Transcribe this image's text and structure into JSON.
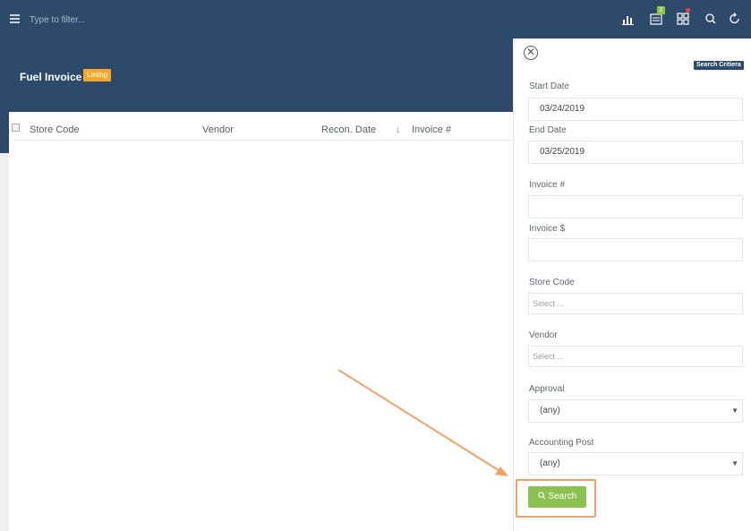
{
  "topbar": {
    "filter_placeholder": "Type to filter...",
    "notification_count": "2",
    "icons": [
      "menu-icon",
      "bar-chart-icon",
      "list-icon",
      "grid-icon",
      "search-icon",
      "refresh-icon"
    ]
  },
  "page": {
    "title": "Fuel Invoice",
    "badge": "Listing"
  },
  "table": {
    "columns": [
      "Store Code",
      "Vendor",
      "Recon. Date",
      "↓",
      "Invoice #"
    ]
  },
  "panel": {
    "badge": "Search Critiera",
    "close_symbol": "✕",
    "start_date_label": "Start Date",
    "start_date_value": "03/24/2019",
    "end_date_label": "End Date",
    "end_date_value": "03/25/2019",
    "invoice_no_label": "Invoice #",
    "invoice_amt_label": "Invoice $",
    "store_code_label": "Store Code",
    "store_code_placeholder": "Select ...",
    "vendor_label": "Vendor",
    "vendor_placeholder": "Select ...",
    "approval_label": "Approval",
    "approval_value": "(any)",
    "accounting_label": "Accounting Post",
    "accounting_value": "(any)",
    "search_label": "Search",
    "caret": "▼"
  },
  "colors": {
    "header": "#2d4a6b",
    "listing_badge": "#f9a825",
    "search_button": "#8cc152",
    "highlight": "#f0a062"
  }
}
